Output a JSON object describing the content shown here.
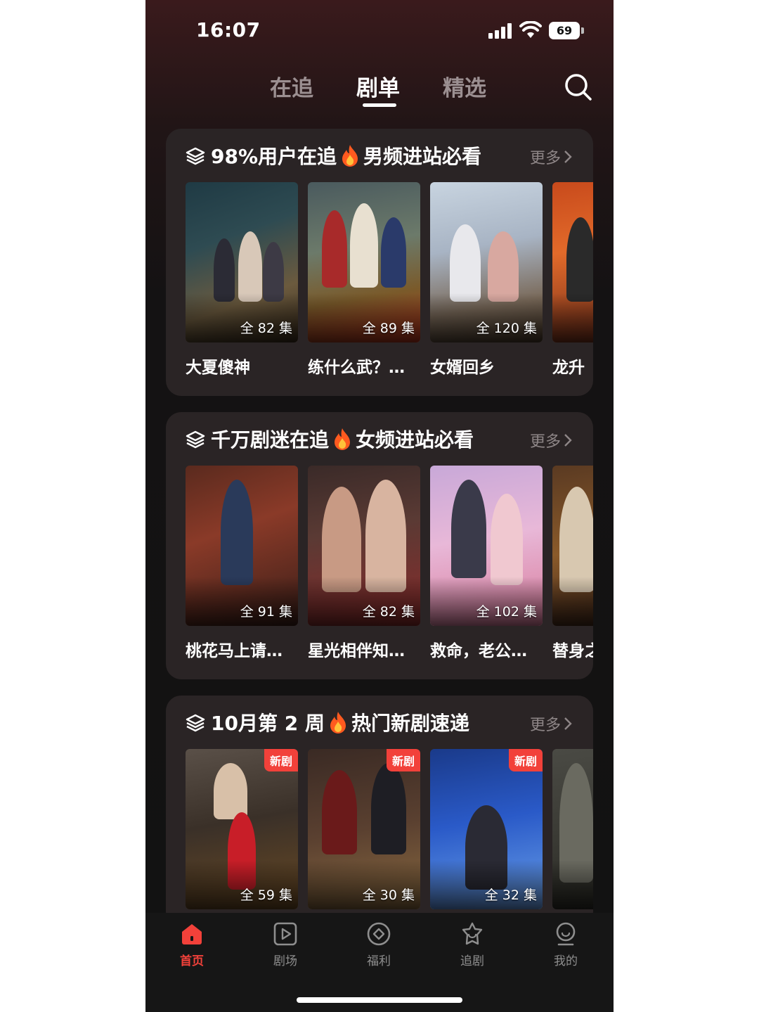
{
  "status_bar": {
    "time": "16:07",
    "battery": "69"
  },
  "top_nav": {
    "tabs": [
      {
        "label": "在追",
        "active": false
      },
      {
        "label": "剧单",
        "active": true
      },
      {
        "label": "精选",
        "active": false
      }
    ],
    "search_icon": "search-icon"
  },
  "sections": [
    {
      "title_left": "98%用户在追",
      "title_right": "男频进站必看",
      "more": "更多",
      "items": [
        {
          "title": "大夏傻神",
          "episodes": "全 82 集"
        },
        {
          "title": "练什么武？…",
          "episodes": "全 89 集"
        },
        {
          "title": "女婿回乡",
          "episodes": "全 120 集"
        },
        {
          "title": "龙升",
          "episodes": ""
        }
      ]
    },
    {
      "title_left": "千万剧迷在追",
      "title_right": "女频进站必看",
      "more": "更多",
      "items": [
        {
          "title": "桃花马上请…",
          "episodes": "全 91 集"
        },
        {
          "title": "星光相伴知…",
          "episodes": "全 82 集"
        },
        {
          "title": "救命，老公…",
          "episodes": "全 102 集"
        },
        {
          "title": "替身之",
          "episodes": ""
        }
      ]
    },
    {
      "title_left": "10月第 2 周",
      "title_right": "热门新剧速递",
      "more": "更多",
      "items": [
        {
          "title": "",
          "episodes": "全 59 集",
          "badge": "新剧"
        },
        {
          "title": "",
          "episodes": "全 30 集",
          "badge": "新剧"
        },
        {
          "title": "",
          "episodes": "全 32 集",
          "badge": "新剧"
        },
        {
          "title": "",
          "episodes": ""
        }
      ]
    }
  ],
  "bottom_nav": [
    {
      "label": "首页",
      "icon": "home-icon",
      "active": true
    },
    {
      "label": "剧场",
      "icon": "play-square-icon",
      "active": false
    },
    {
      "label": "福利",
      "icon": "coin-icon",
      "active": false
    },
    {
      "label": "追剧",
      "icon": "star-bag-icon",
      "active": false
    },
    {
      "label": "我的",
      "icon": "profile-icon",
      "active": false
    }
  ],
  "colors": {
    "accent": "#f2413a",
    "card_bg": "#2a2425",
    "page_bg": "#141213"
  }
}
